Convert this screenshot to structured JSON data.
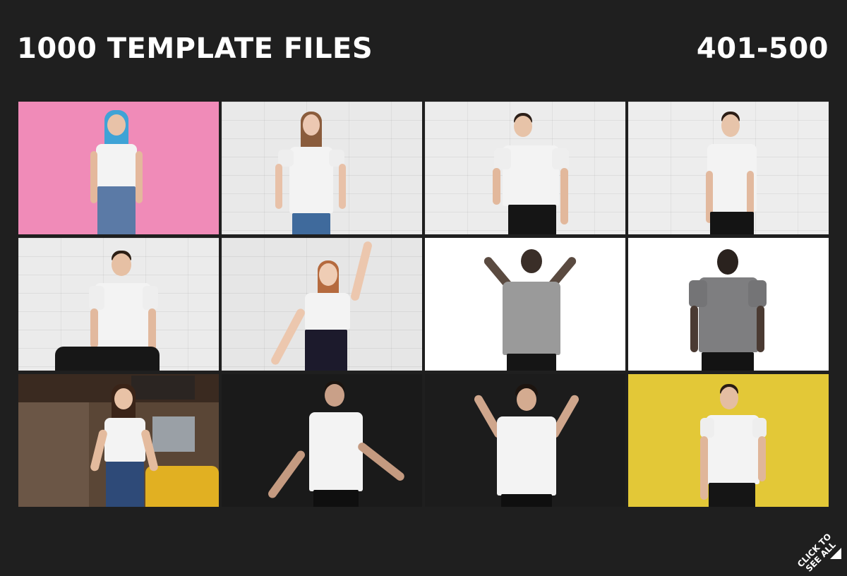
{
  "header": {
    "title": "1000 TEMPLATE FILES",
    "range": "401-500"
  },
  "tiles": [
    {
      "name": "tile-woman-blue-hair-pink",
      "bg": "#f08bb8"
    },
    {
      "name": "tile-woman-white-brick",
      "bg": "#e9e9e9"
    },
    {
      "name": "tile-man-lean-brick",
      "bg": "#ececec"
    },
    {
      "name": "tile-man-hands-front-brick",
      "bg": "#ededed"
    },
    {
      "name": "tile-man-seated-brick",
      "bg": "#ebebeb"
    },
    {
      "name": "tile-woman-arm-raised-brick",
      "bg": "#e6e6e6"
    },
    {
      "name": "tile-man-backlit-hands-head",
      "bg": "#ffffff"
    },
    {
      "name": "tile-man-back-view",
      "bg": "#ffffff"
    },
    {
      "name": "tile-woman-cafe",
      "bg": "#5a4636"
    },
    {
      "name": "tile-man-dark-arms-out",
      "bg": "#1a1a1a"
    },
    {
      "name": "tile-man-dark-hands-head",
      "bg": "#1c1c1c"
    },
    {
      "name": "tile-man-yellow",
      "bg": "#e3c837"
    }
  ],
  "corner": {
    "line1": "CLICK TO",
    "line2": "SEE ALL"
  }
}
